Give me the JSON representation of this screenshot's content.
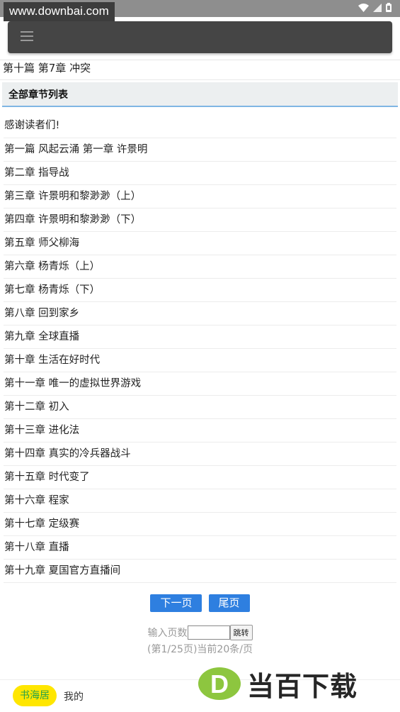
{
  "status_bar": {
    "watermark": "www.downbai.com",
    "icons": [
      "wifi-icon",
      "signal-icon",
      "battery-icon"
    ]
  },
  "app_bar": {
    "menu_icon": "hamburger-menu-icon"
  },
  "current_chapter": "第十篇 第7章 冲突",
  "chapter_list": {
    "header": "全部章节列表",
    "items": [
      "感谢读者们!",
      "第一篇 风起云涌 第一章 许景明",
      "第二章 指导战",
      "第三章 许景明和黎渺渺（上）",
      "第四章 许景明和黎渺渺（下）",
      "第五章 师父柳海",
      "第六章 杨青烁（上）",
      "第七章 杨青烁（下）",
      "第八章 回到家乡",
      "第九章 全球直播",
      "第十章 生活在好时代",
      "第十一章 唯一的虚拟世界游戏",
      "第十二章 初入",
      "第十三章 进化法",
      "第十四章 真实的冷兵器战斗",
      "第十五章 时代变了",
      "第十六章 程家",
      "第十七章 定级赛",
      "第十八章 直播",
      "第十九章 夏国官方直播间"
    ]
  },
  "pagination": {
    "next_label": "下一页",
    "last_label": "尾页",
    "jump_label": "输入页数",
    "jump_input_value": "",
    "jump_button": "跳转",
    "page_info": "(第1/25页)当前20条/页"
  },
  "bottom_nav": {
    "shuhai_label": "书海居",
    "mine_label": "我的"
  },
  "brand_watermark": {
    "letter": "D",
    "text": "当百下载"
  },
  "colors": {
    "status_bar": "#8e8e8e",
    "app_bar": "#454545",
    "accent_blue": "#2e7fe0",
    "header_bg": "#eceff0",
    "header_underline": "#7fb6e4",
    "shuhai_bg": "#ffe600",
    "shuhai_text": "#24a24a",
    "brand_green": "#8dc63f"
  }
}
